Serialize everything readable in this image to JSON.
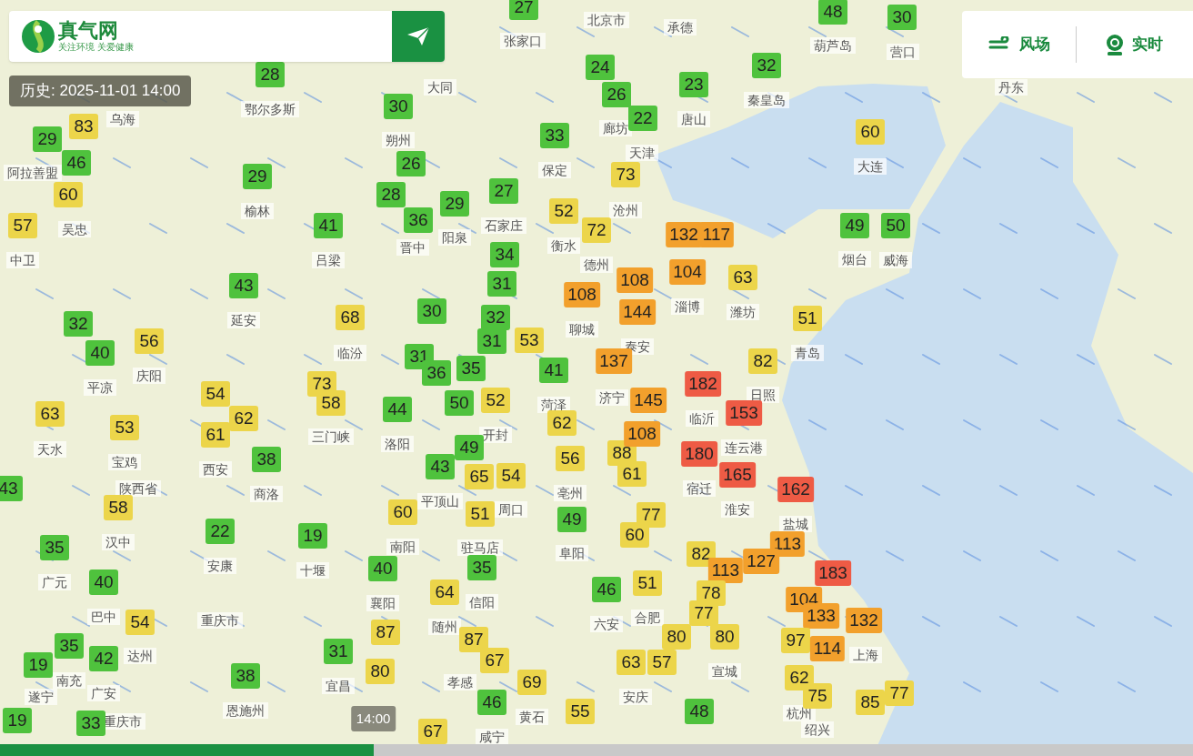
{
  "header": {
    "logo": "真气网",
    "slogan": "关注环境 关爱健康",
    "history": "历史: 2025-11-01 14:00"
  },
  "toolbar": [
    {
      "label": "风场",
      "kind": "wind"
    },
    {
      "label": "实时",
      "kind": "camera"
    }
  ],
  "markers": [
    {
      "value": "27",
      "color": "#4fc23d"
    },
    {
      "value": "48",
      "color": "#4fc23d"
    },
    {
      "value": "30",
      "color": "#4fc23d"
    },
    {
      "value": "28",
      "color": "#4fc23d"
    },
    {
      "value": "24",
      "color": "#4fc23d"
    },
    {
      "value": "32",
      "color": "#4fc23d"
    },
    {
      "value": "26",
      "color": "#4fc23d"
    },
    {
      "value": "23",
      "color": "#4fc23d"
    },
    {
      "value": "83",
      "color": "#ecd54a"
    },
    {
      "value": "30",
      "color": "#4fc23d"
    },
    {
      "value": "22",
      "color": "#4fc23d"
    },
    {
      "value": "29",
      "color": "#4fc23d"
    },
    {
      "value": "33",
      "color": "#4fc23d"
    },
    {
      "value": "60",
      "color": "#ecd54a"
    },
    {
      "value": "46",
      "color": "#4fc23d"
    },
    {
      "value": "29",
      "color": "#4fc23d"
    },
    {
      "value": "26",
      "color": "#4fc23d"
    },
    {
      "value": "73",
      "color": "#ecd54a"
    },
    {
      "value": "60",
      "color": "#ecd54a"
    },
    {
      "value": "28",
      "color": "#4fc23d"
    },
    {
      "value": "27",
      "color": "#4fc23d"
    },
    {
      "value": "57",
      "color": "#ecd54a"
    },
    {
      "value": "41",
      "color": "#4fc23d"
    },
    {
      "value": "36",
      "color": "#4fc23d"
    },
    {
      "value": "29",
      "color": "#4fc23d"
    },
    {
      "value": "52",
      "color": "#ecd54a"
    },
    {
      "value": "72",
      "color": "#ecd54a"
    },
    {
      "value": "132",
      "color": "#f2a02c"
    },
    {
      "value": "117",
      "color": "#f2a02c"
    },
    {
      "value": "49",
      "color": "#4fc23d"
    },
    {
      "value": "50",
      "color": "#4fc23d"
    },
    {
      "value": "34",
      "color": "#4fc23d"
    },
    {
      "value": "104",
      "color": "#f2a02c"
    },
    {
      "value": "63",
      "color": "#ecd54a"
    },
    {
      "value": "43",
      "color": "#4fc23d"
    },
    {
      "value": "31",
      "color": "#4fc23d"
    },
    {
      "value": "108",
      "color": "#f2a02c"
    },
    {
      "value": "108",
      "color": "#f2a02c"
    },
    {
      "value": "32",
      "color": "#4fc23d"
    },
    {
      "value": "68",
      "color": "#ecd54a"
    },
    {
      "value": "30",
      "color": "#4fc23d"
    },
    {
      "value": "32",
      "color": "#4fc23d"
    },
    {
      "value": "144",
      "color": "#f2a02c"
    },
    {
      "value": "51",
      "color": "#ecd54a"
    },
    {
      "value": "40",
      "color": "#4fc23d"
    },
    {
      "value": "56",
      "color": "#ecd54a"
    },
    {
      "value": "31",
      "color": "#4fc23d"
    },
    {
      "value": "53",
      "color": "#ecd54a"
    },
    {
      "value": "31",
      "color": "#4fc23d"
    },
    {
      "value": "36",
      "color": "#4fc23d"
    },
    {
      "value": "35",
      "color": "#4fc23d"
    },
    {
      "value": "41",
      "color": "#4fc23d"
    },
    {
      "value": "137",
      "color": "#f2a02c"
    },
    {
      "value": "82",
      "color": "#ecd54a"
    },
    {
      "value": "54",
      "color": "#ecd54a"
    },
    {
      "value": "73",
      "color": "#ecd54a"
    },
    {
      "value": "58",
      "color": "#ecd54a"
    },
    {
      "value": "50",
      "color": "#4fc23d"
    },
    {
      "value": "52",
      "color": "#ecd54a"
    },
    {
      "value": "145",
      "color": "#f2a02c"
    },
    {
      "value": "182",
      "color": "#ee5b45"
    },
    {
      "value": "63",
      "color": "#ecd54a"
    },
    {
      "value": "53",
      "color": "#ecd54a"
    },
    {
      "value": "62",
      "color": "#ecd54a"
    },
    {
      "value": "44",
      "color": "#4fc23d"
    },
    {
      "value": "62",
      "color": "#ecd54a"
    },
    {
      "value": "153",
      "color": "#ee5b45"
    },
    {
      "value": "61",
      "color": "#ecd54a"
    },
    {
      "value": "49",
      "color": "#4fc23d"
    },
    {
      "value": "88",
      "color": "#ecd54a"
    },
    {
      "value": "108",
      "color": "#f2a02c"
    },
    {
      "value": "180",
      "color": "#ee5b45"
    },
    {
      "value": "38",
      "color": "#4fc23d"
    },
    {
      "value": "43",
      "color": "#4fc23d"
    },
    {
      "value": "65",
      "color": "#ecd54a"
    },
    {
      "value": "54",
      "color": "#ecd54a"
    },
    {
      "value": "56",
      "color": "#ecd54a"
    },
    {
      "value": "61",
      "color": "#ecd54a"
    },
    {
      "value": "165",
      "color": "#ee5b45"
    },
    {
      "value": "43",
      "color": "#4fc23d"
    },
    {
      "value": "58",
      "color": "#ecd54a"
    },
    {
      "value": "162",
      "color": "#ee5b45"
    },
    {
      "value": "22",
      "color": "#4fc23d"
    },
    {
      "value": "60",
      "color": "#ecd54a"
    },
    {
      "value": "51",
      "color": "#ecd54a"
    },
    {
      "value": "49",
      "color": "#4fc23d"
    },
    {
      "value": "77",
      "color": "#ecd54a"
    },
    {
      "value": "35",
      "color": "#4fc23d"
    },
    {
      "value": "19",
      "color": "#4fc23d"
    },
    {
      "value": "60",
      "color": "#ecd54a"
    },
    {
      "value": "82",
      "color": "#ecd54a"
    },
    {
      "value": "113",
      "color": "#f2a02c"
    },
    {
      "value": "40",
      "color": "#4fc23d"
    },
    {
      "value": "40",
      "color": "#4fc23d"
    },
    {
      "value": "35",
      "color": "#4fc23d"
    },
    {
      "value": "51",
      "color": "#ecd54a"
    },
    {
      "value": "113",
      "color": "#f2a02c"
    },
    {
      "value": "127",
      "color": "#f2a02c"
    },
    {
      "value": "183",
      "color": "#ee5b45"
    },
    {
      "value": "64",
      "color": "#ecd54a"
    },
    {
      "value": "46",
      "color": "#4fc23d"
    },
    {
      "value": "78",
      "color": "#ecd54a"
    },
    {
      "value": "104",
      "color": "#f2a02c"
    },
    {
      "value": "54",
      "color": "#ecd54a"
    },
    {
      "value": "87",
      "color": "#ecd54a"
    },
    {
      "value": "77",
      "color": "#ecd54a"
    },
    {
      "value": "133",
      "color": "#f2a02c"
    },
    {
      "value": "132",
      "color": "#f2a02c"
    },
    {
      "value": "35",
      "color": "#4fc23d"
    },
    {
      "value": "42",
      "color": "#4fc23d"
    },
    {
      "value": "31",
      "color": "#4fc23d"
    },
    {
      "value": "87",
      "color": "#ecd54a"
    },
    {
      "value": "67",
      "color": "#ecd54a"
    },
    {
      "value": "80",
      "color": "#ecd54a"
    },
    {
      "value": "80",
      "color": "#ecd54a"
    },
    {
      "value": "97",
      "color": "#ecd54a"
    },
    {
      "value": "114",
      "color": "#f2a02c"
    },
    {
      "value": "19",
      "color": "#4fc23d"
    },
    {
      "value": "38",
      "color": "#4fc23d"
    },
    {
      "value": "80",
      "color": "#ecd54a"
    },
    {
      "value": "69",
      "color": "#ecd54a"
    },
    {
      "value": "63",
      "color": "#ecd54a"
    },
    {
      "value": "57",
      "color": "#ecd54a"
    },
    {
      "value": "62",
      "color": "#ecd54a"
    },
    {
      "value": "46",
      "color": "#4fc23d"
    },
    {
      "value": "55",
      "color": "#ecd54a"
    },
    {
      "value": "48",
      "color": "#4fc23d"
    },
    {
      "value": "75",
      "color": "#ecd54a"
    },
    {
      "value": "85",
      "color": "#ecd54a"
    },
    {
      "value": "77",
      "color": "#ecd54a"
    },
    {
      "value": "19",
      "color": "#4fc23d"
    },
    {
      "value": "33",
      "color": "#4fc23d"
    },
    {
      "value": "67",
      "color": "#ecd54a"
    }
  ],
  "cities": [
    {
      "text": "北京市"
    },
    {
      "text": "张家口"
    },
    {
      "text": "承德"
    },
    {
      "text": "葫芦岛"
    },
    {
      "text": "营口"
    },
    {
      "text": "大同"
    },
    {
      "text": "秦皇岛"
    },
    {
      "text": "丹东"
    },
    {
      "text": "乌海"
    },
    {
      "text": "鄂尔多斯"
    },
    {
      "text": "唐山"
    },
    {
      "text": "朔州"
    },
    {
      "text": "廊坊"
    },
    {
      "text": "阿拉善盟"
    },
    {
      "text": "保定"
    },
    {
      "text": "天津"
    },
    {
      "text": "大连"
    },
    {
      "text": "榆林"
    },
    {
      "text": "石家庄"
    },
    {
      "text": "沧州"
    },
    {
      "text": "吴忠"
    },
    {
      "text": "晋中"
    },
    {
      "text": "阳泉"
    },
    {
      "text": "衡水"
    },
    {
      "text": "中卫"
    },
    {
      "text": "吕梁"
    },
    {
      "text": "德州"
    },
    {
      "text": "烟台"
    },
    {
      "text": "威海"
    },
    {
      "text": "延安"
    },
    {
      "text": "聊城"
    },
    {
      "text": "淄博"
    },
    {
      "text": "潍坊"
    },
    {
      "text": "临汾"
    },
    {
      "text": "泰安"
    },
    {
      "text": "青岛"
    },
    {
      "text": "庆阳"
    },
    {
      "text": "平凉"
    },
    {
      "text": "菏泽"
    },
    {
      "text": "济宁"
    },
    {
      "text": "日照"
    },
    {
      "text": "临沂"
    },
    {
      "text": "天水"
    },
    {
      "text": "三门峡"
    },
    {
      "text": "洛阳"
    },
    {
      "text": "开封"
    },
    {
      "text": "连云港"
    },
    {
      "text": "宝鸡"
    },
    {
      "text": "西安"
    },
    {
      "text": "陕西省"
    },
    {
      "text": "商洛"
    },
    {
      "text": "平顶山"
    },
    {
      "text": "亳州"
    },
    {
      "text": "宿迁"
    },
    {
      "text": "周口"
    },
    {
      "text": "淮安"
    },
    {
      "text": "盐城"
    },
    {
      "text": "汉中"
    },
    {
      "text": "南阳"
    },
    {
      "text": "驻马店"
    },
    {
      "text": "阜阳"
    },
    {
      "text": "广元"
    },
    {
      "text": "安康"
    },
    {
      "text": "十堰"
    },
    {
      "text": "襄阳"
    },
    {
      "text": "信阳"
    },
    {
      "text": "巴中"
    },
    {
      "text": "重庆市"
    },
    {
      "text": "随州"
    },
    {
      "text": "六安"
    },
    {
      "text": "合肥"
    },
    {
      "text": "达州"
    },
    {
      "text": "上海"
    },
    {
      "text": "南充"
    },
    {
      "text": "宜昌"
    },
    {
      "text": "孝感"
    },
    {
      "text": "宣城"
    },
    {
      "text": "遂宁"
    },
    {
      "text": "广安"
    },
    {
      "text": "恩施州"
    },
    {
      "text": "安庆"
    },
    {
      "text": "重庆市"
    },
    {
      "text": "咸宁"
    },
    {
      "text": "黄石"
    },
    {
      "text": "杭州"
    },
    {
      "text": "绍兴"
    }
  ],
  "timeline": {
    "time": "14:00",
    "level": 0.313
  }
}
